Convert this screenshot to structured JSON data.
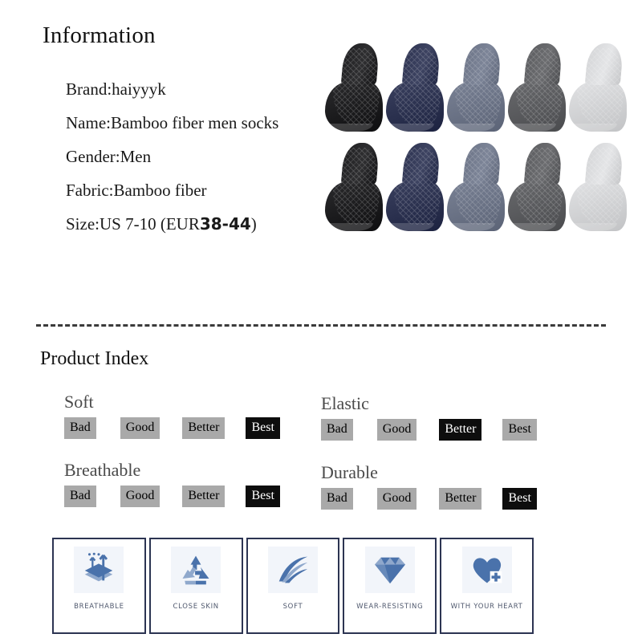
{
  "information": {
    "title": "Information",
    "lines": [
      {
        "text": "Brand:haiyyyk"
      },
      {
        "text": "Name:Bamboo fiber men socks"
      },
      {
        "text": "Gender:Men"
      },
      {
        "text": "Fabric:Bamboo fiber"
      },
      {
        "text": "Size:US 7-10 (EUR",
        "bold": "38-44",
        "tail": ")"
      }
    ]
  },
  "product_photo": {
    "alt": "Ten ankle socks arranged in two rows of five",
    "rows": 2,
    "per_row": 5,
    "colors": [
      "#1d1d1f",
      "#2c3250",
      "#6b7386",
      "#5a5b5e",
      "#d2d3d5"
    ],
    "color_names": [
      "black",
      "navy-blue",
      "slate-blue-gray",
      "dark-gray",
      "light-gray"
    ]
  },
  "divider": {
    "style": "dashed",
    "color": "#3b3b3b"
  },
  "product_index": {
    "title": "Product Index",
    "scale": [
      "Bad",
      "Good",
      "Better",
      "Best"
    ],
    "metrics": [
      {
        "name": "Soft",
        "selected": "Best",
        "selected_index": 3
      },
      {
        "name": "Elastic",
        "selected": "Better",
        "selected_index": 2
      },
      {
        "name": "Breathable",
        "selected": "Best",
        "selected_index": 3
      },
      {
        "name": "Durable",
        "selected": "Best",
        "selected_index": 3
      }
    ]
  },
  "features": {
    "accent_color": "#4a72ab",
    "border_color": "#2c3452",
    "items": [
      {
        "label": "BREATHABLE",
        "icon": "breathable-arrows-icon"
      },
      {
        "label": "CLOSE SKIN",
        "icon": "recycle-icon"
      },
      {
        "label": "SOFT",
        "icon": "feather-icon"
      },
      {
        "label": "WEAR-RESISTING",
        "icon": "diamond-icon"
      },
      {
        "label": "WITH YOUR HEART",
        "icon": "heart-plus-icon"
      }
    ]
  }
}
